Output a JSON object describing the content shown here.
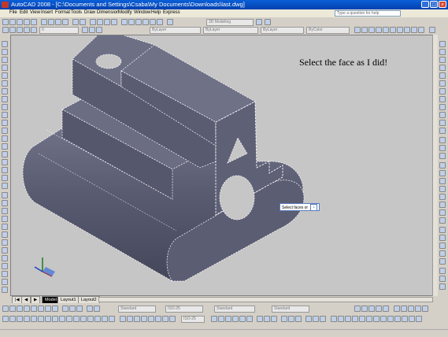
{
  "window": {
    "title": "AutoCAD 2008 - [C:\\Documents and Settings\\Csaba\\My Documents\\Downloads\\last.dwg]",
    "controls": [
      "_",
      "□",
      "×"
    ]
  },
  "menubar": {
    "items": [
      "File",
      "Edit",
      "View",
      "Insert",
      "Format",
      "Tools",
      "Draw",
      "Dimension",
      "Modify",
      "Window",
      "Help",
      "Express"
    ],
    "help_placeholder": "Type a question for help"
  },
  "toolbar": {
    "workspace": "3D Modeling",
    "layer": "0",
    "color": "ByLayer",
    "linetype": "ByLayer",
    "lineweight": "ByLayer",
    "plotstyle": "ByColor"
  },
  "bottom_toolbar": {
    "text_style": "Standard",
    "iso_style": "ISO-25",
    "table_style": "Standard",
    "mleader_style": "Standard",
    "scale": "ISO-25"
  },
  "canvas": {
    "note": "Select the face as I did!",
    "tooltip": "Select faces or",
    "tooltip_icon": "↓"
  },
  "layout_tabs": [
    "Model",
    "Layout1",
    "Layout2"
  ],
  "colors": {
    "model_fill": "#5e6076",
    "model_top": "#6d6f85",
    "model_dark": "#4c4e62",
    "model_edge": "#ffffff",
    "canvas_bg": "#c6c6c6"
  }
}
